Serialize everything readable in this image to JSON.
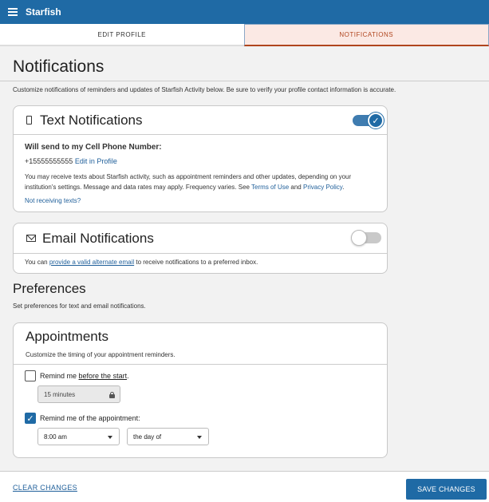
{
  "app": {
    "title": "Starfish"
  },
  "tabs": [
    {
      "label": "EDIT PROFILE"
    },
    {
      "label": "NOTIFICATIONS"
    }
  ],
  "page": {
    "title": "Notifications",
    "description": "Customize notifications of reminders and updates of Starfish Activity below. Be sure to verify your profile contact information is accurate."
  },
  "text_notifications": {
    "title": "Text Notifications",
    "enabled": true,
    "send_label": "Will send to my Cell Phone Number:",
    "phone": "+15555555555",
    "edit_link": "Edit in Profile",
    "info_prefix": "You may receive texts about Starfish activity, such as appointment reminders and other updates, depending on your institution's settings. Message and data rates may apply. Frequency varies. See",
    "terms_link": "Terms of Use",
    "and_text": "and",
    "privacy_link": "Privacy Policy",
    "period": ".",
    "not_receiving": "Not receiving texts?"
  },
  "email_notifications": {
    "title": "Email Notifications",
    "enabled": false,
    "prefix": "You can",
    "alt_link": "provide a valid alternate email",
    "suffix": "to receive notifications to a preferred inbox."
  },
  "preferences": {
    "title": "Preferences",
    "description": "Set preferences for text and email notifications."
  },
  "appointments": {
    "title": "Appointments",
    "description": "Customize the timing of your appointment reminders.",
    "remind_before": {
      "label_prefix": "Remind me",
      "label_bold": "before the start",
      "label_suffix": ".",
      "checked": false,
      "value": "15 minutes"
    },
    "remind_of": {
      "label": "Remind me of the appointment:",
      "checked": true,
      "time": "8:00 am",
      "day": "the day of"
    }
  },
  "footer": {
    "clear_label": "CLEAR CHANGES",
    "save_label": "SAVE CHANGES"
  },
  "colors": {
    "brand": "#1f6aa5",
    "active_tab_text": "#b0451e",
    "active_tab_bg": "#fbe9e4"
  }
}
